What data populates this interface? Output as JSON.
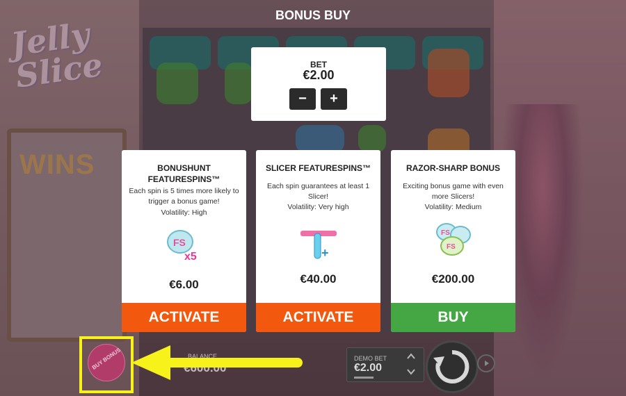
{
  "game": {
    "logo": "Jelly Slice",
    "wins_label": "WINS"
  },
  "modal": {
    "title": "BONUS BUY"
  },
  "bet": {
    "label": "BET",
    "value": "€2.00",
    "minus": "−",
    "plus": "+"
  },
  "cards": [
    {
      "name": "BONUSHUNT FEATURESPINS™",
      "desc": "Each spin is 5 times more likely to trigger a bonus game!",
      "volatility": "Volatility: High",
      "price": "€6.00",
      "action": "ACTIVATE",
      "icon": "featurespins-x5-icon"
    },
    {
      "name": "SLICER FEATURESPINS™",
      "desc": "Each spin guarantees at least 1 Slicer!",
      "volatility": "Volatility: Very high",
      "price": "€40.00",
      "action": "ACTIVATE",
      "icon": "slicer-plus-icon"
    },
    {
      "name": "RAZOR-SHARP BONUS",
      "desc": "Exciting bonus game with even more Slicers!",
      "volatility": "Volatility: Medium",
      "price": "€200.00",
      "action": "BUY",
      "icon": "razor-sharp-bonus-icon"
    }
  ],
  "footer": {
    "balance_label": "BALANCE",
    "balance_value": "€600.00",
    "demo_bet_label": "DEMO BET",
    "demo_bet_value": "€2.00",
    "buy_bonus_label": "BUY BONUS"
  },
  "colors": {
    "activate": "#f3580f",
    "buy": "#44a744",
    "highlight": "#f7f31a",
    "arrow": "#f7f31a"
  }
}
